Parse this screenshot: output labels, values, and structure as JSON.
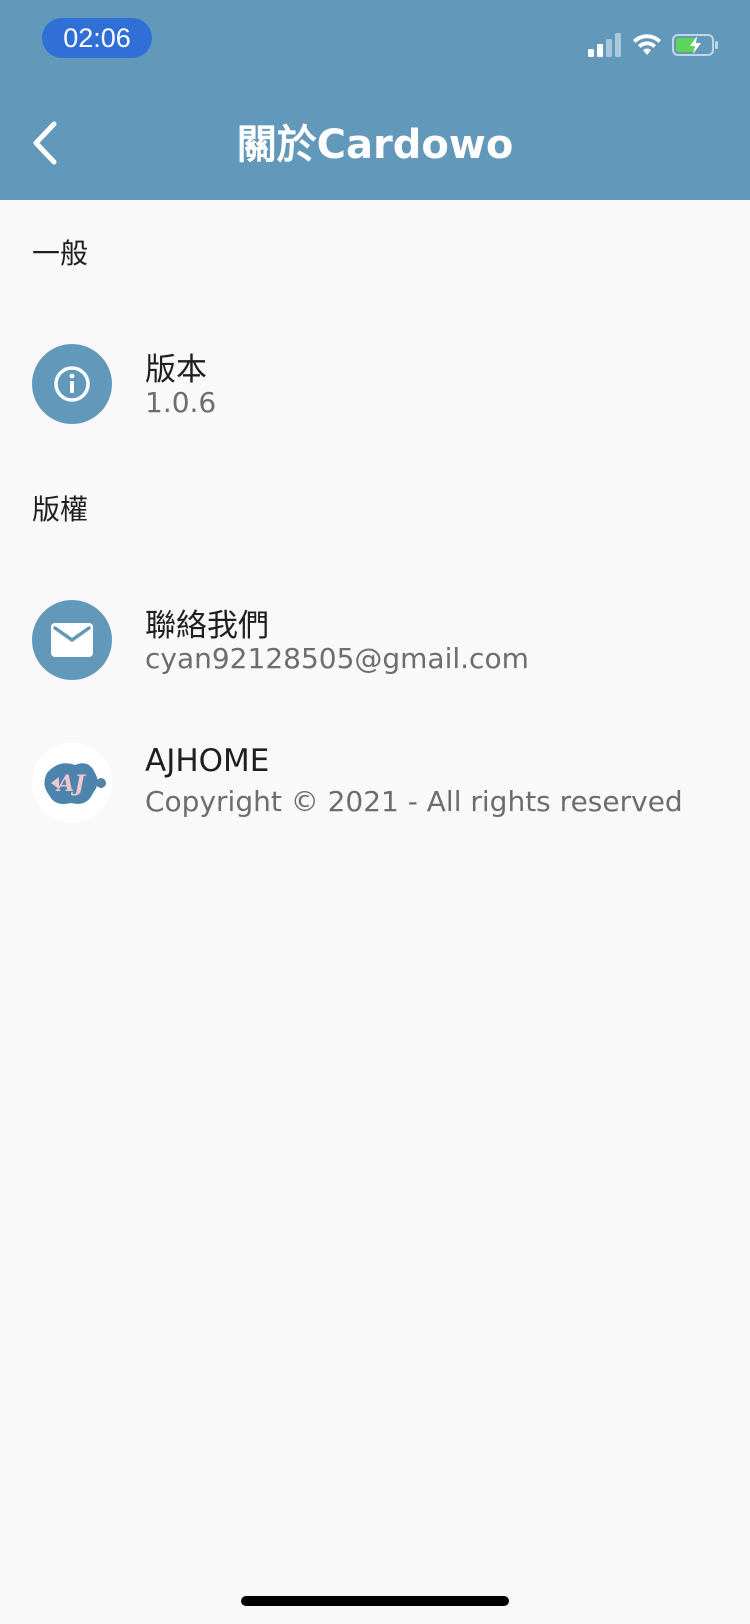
{
  "status_bar": {
    "time": "02:06"
  },
  "header": {
    "title": "關於Cardowo",
    "back_icon": "chevron-left-icon",
    "bg_color": "#6299ba"
  },
  "sections": [
    {
      "label": "一般",
      "items": [
        {
          "title": "版本",
          "subtitle": "1.0.6",
          "icon": "info-icon"
        }
      ]
    },
    {
      "label": "版權",
      "items": [
        {
          "title": "聯絡我們",
          "subtitle": "cyan92128505@gmail.com",
          "icon": "mail-icon"
        },
        {
          "title": "AJHOME",
          "subtitle": "Copyright © 2021 - All rights reserved",
          "icon": "ajhome-logo",
          "logo_text": "AJ"
        }
      ]
    }
  ]
}
